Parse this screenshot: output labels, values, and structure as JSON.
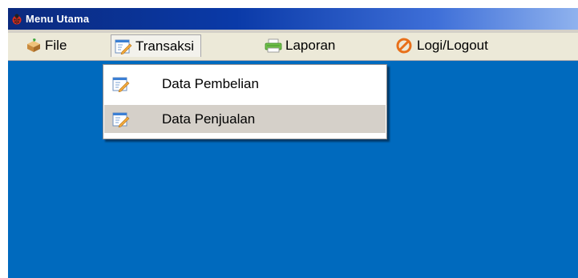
{
  "window": {
    "title": "Menu Utama",
    "title_icon": "ladybug-app-icon",
    "background_color": "#006abe"
  },
  "menubar": {
    "items": [
      {
        "label": "File",
        "icon": "package-icon"
      },
      {
        "label": "Transaksi",
        "icon": "edit-document-icon",
        "state": "open"
      },
      {
        "label": "Laporan",
        "icon": "printer-icon"
      },
      {
        "label": "Logi/Logout",
        "icon": "no-entry-icon"
      }
    ]
  },
  "dropdown": {
    "items": [
      {
        "label": "Data Pembelian",
        "icon": "edit-document-icon"
      },
      {
        "label": "Data Penjualan",
        "icon": "edit-document-icon",
        "state": "highlighted"
      }
    ]
  }
}
